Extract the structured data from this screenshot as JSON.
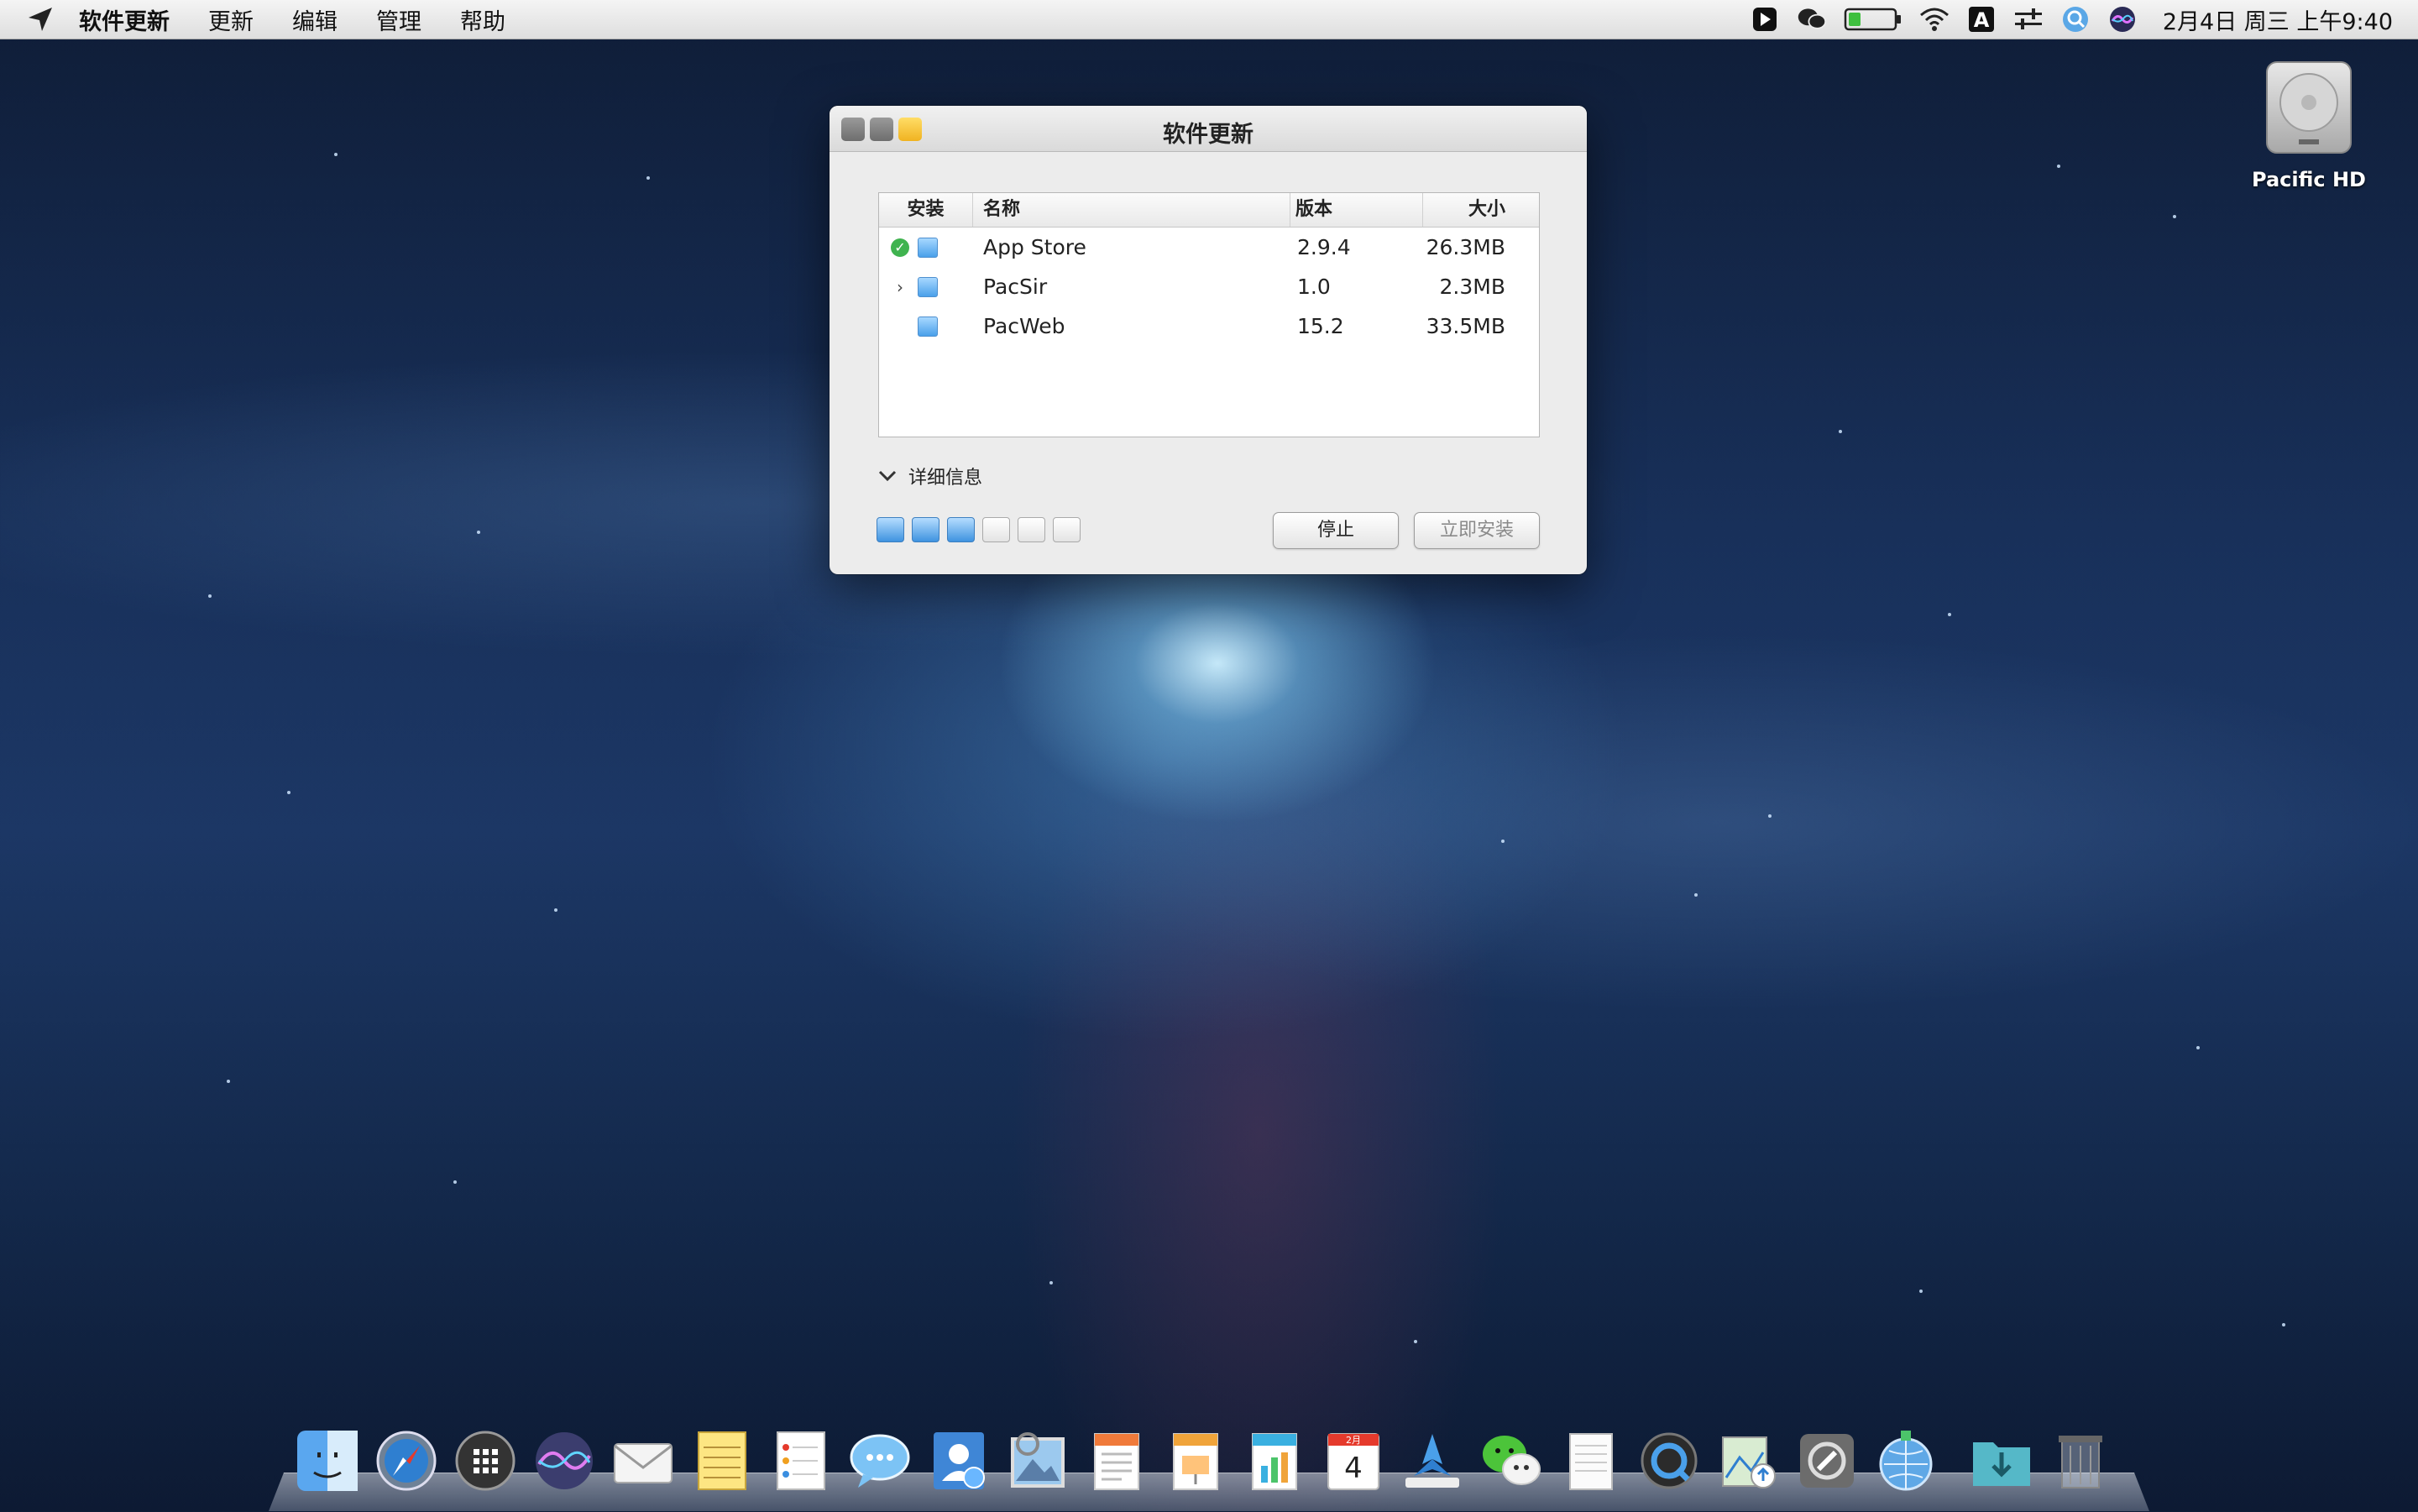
{
  "menubar": {
    "app_name": "软件更新",
    "items": [
      "更新",
      "编辑",
      "管理",
      "帮助"
    ],
    "clock": "2月4日 周三 上午9:40",
    "tray_icons": [
      "cursor-app-icon",
      "wechat-icon",
      "battery-icon",
      "wifi-icon",
      "input-method-icon",
      "controls-icon",
      "spotlight-icon",
      "siri-icon"
    ]
  },
  "desktop": {
    "drive_label": "Pacific HD"
  },
  "window": {
    "title": "软件更新",
    "table": {
      "headers": {
        "install": "安装",
        "name": "名称",
        "version": "版本",
        "size": "大小"
      },
      "rows": [
        {
          "name": "App Store",
          "version": "2.9.4",
          "size": "26.3MB",
          "status": "installed"
        },
        {
          "name": "PacSir",
          "version": "1.0",
          "size": "2.3MB",
          "status": "expand"
        },
        {
          "name": "PacWeb",
          "version": "15.2",
          "size": "33.5MB",
          "status": "none"
        }
      ]
    },
    "details_label": "详细信息",
    "progress": {
      "filled": 3,
      "total": 6
    },
    "stop_label": "停止",
    "install_label": "立即安装"
  },
  "calendar_icon": {
    "month": "2月",
    "day": "4"
  },
  "dock": [
    "finder",
    "safari",
    "launchpad",
    "siri",
    "mail",
    "notes",
    "reminders",
    "messages",
    "contacts",
    "preview",
    "pages",
    "keynote",
    "numbers",
    "calendar",
    "testflight",
    "wechat",
    "textedit",
    "quicktime",
    "app-installer",
    "system-preferences",
    "network-utility",
    "downloads",
    "trash"
  ]
}
